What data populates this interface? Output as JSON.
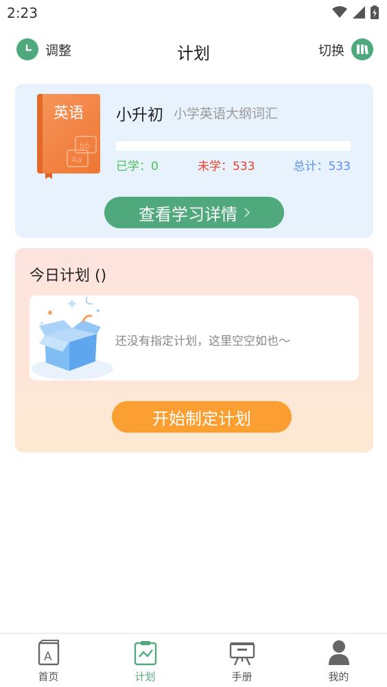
{
  "status_bar": {
    "time": "2:23"
  },
  "header": {
    "left_label": "调整",
    "title": "计划",
    "right_label": "切换"
  },
  "book": {
    "cover_title": "英语",
    "name": "小升初",
    "description": "小学英语大纲词汇",
    "progress": 0,
    "learned_label": "已学：",
    "learned_value": "0",
    "unlearned_label": "未学：",
    "unlearned_value": "533",
    "total_label": "总计：",
    "total_value": "533",
    "detail_button": "查看学习详情"
  },
  "plan": {
    "title": "今日计划 ()",
    "empty_text": "还没有指定计划，这里空空如也～",
    "start_button": "开始制定计划"
  },
  "nav": [
    {
      "label": "首页",
      "icon": "book-icon"
    },
    {
      "label": "计划",
      "icon": "chart-icon"
    },
    {
      "label": "手册",
      "icon": "easel-icon"
    },
    {
      "label": "我的",
      "icon": "user-icon"
    }
  ],
  "colors": {
    "accent": "#4fa97c",
    "orange": "#fb9f32",
    "learned": "#4cc159",
    "unlearned": "#e8432c",
    "total": "#5b8ff2"
  }
}
